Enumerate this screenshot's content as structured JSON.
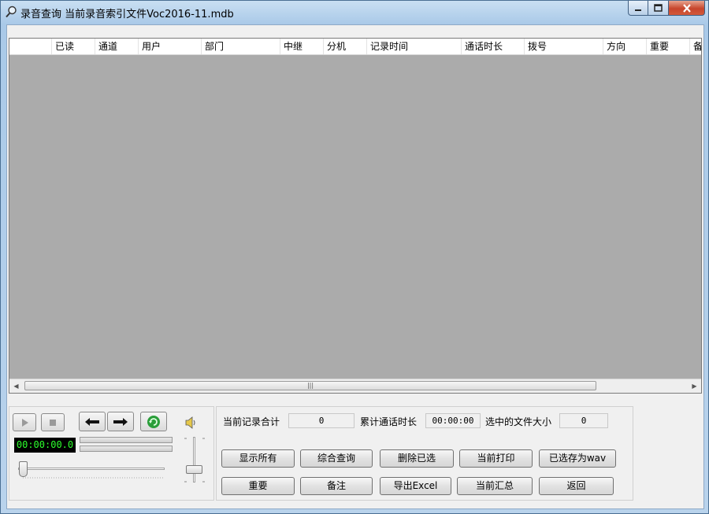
{
  "window": {
    "title": "录音查询 当前录音索引文件Voc2016-11.mdb"
  },
  "grid": {
    "columns": [
      "已读",
      "通道",
      "用户",
      "部门",
      "中继",
      "分机",
      "记录时间",
      "通话时长",
      "拨号",
      "方向",
      "重要",
      "备注"
    ]
  },
  "player": {
    "time": "00:00:00.0"
  },
  "stats": {
    "total_label": "当前记录合计",
    "total_value": "0",
    "duration_label": "累计通话时长",
    "duration_value": "00:00:00",
    "size_label": "选中的文件大小",
    "size_value": "0"
  },
  "buttons": {
    "show_all": "显示所有",
    "combo_query": "综合查询",
    "delete_selected": "删除已选",
    "print_current": "当前打印",
    "save_wav": "已选存为wav",
    "important": "重要",
    "note": "备注",
    "export_excel": "导出Excel",
    "summary": "当前汇总",
    "back": "返回"
  },
  "colors": {
    "timer_text": "#2cff2c",
    "grid_bg": "#ababab"
  }
}
